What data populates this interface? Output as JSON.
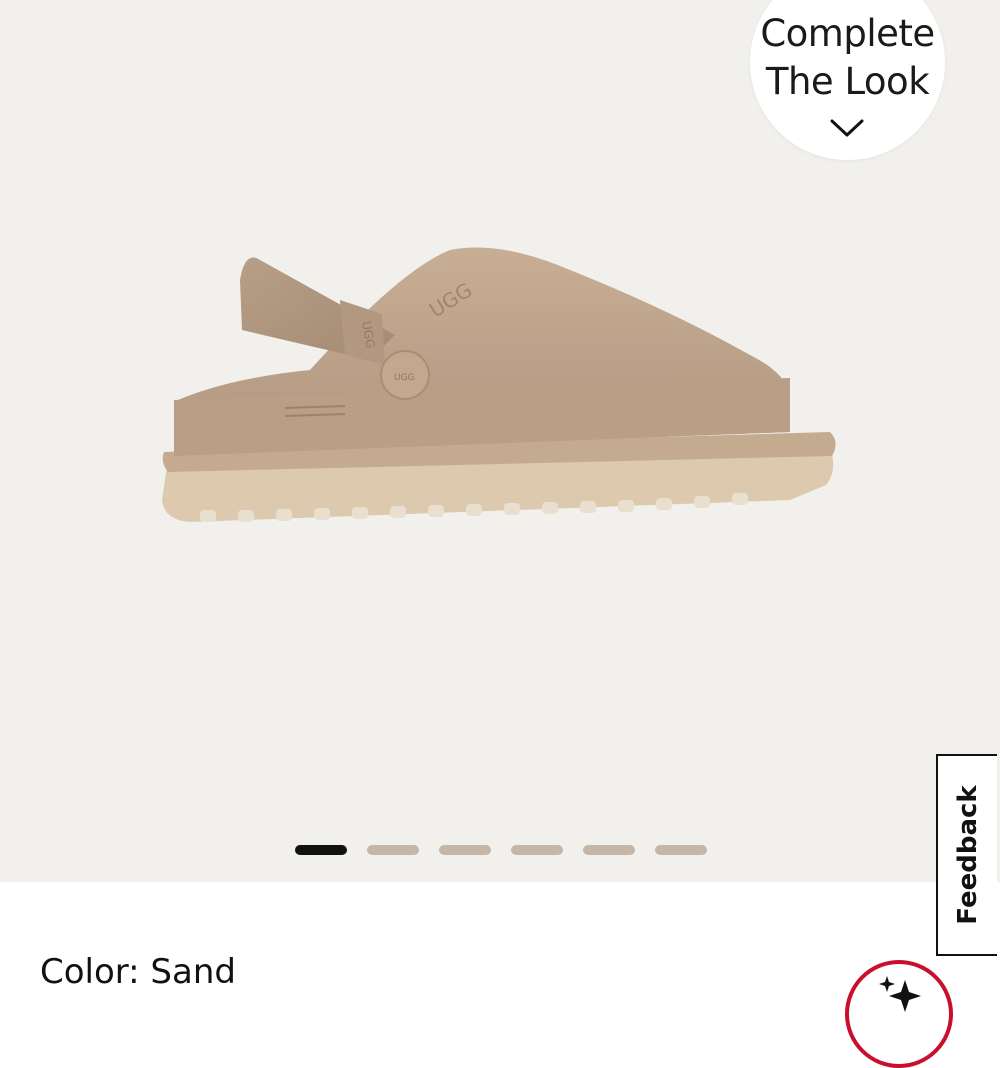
{
  "gallery": {
    "product_image_alt": "UGG",
    "slide_count": 6,
    "active_slide": 1
  },
  "complete_look": {
    "line1": "Complete",
    "line2": "The Look",
    "icon": "chevron-down-icon"
  },
  "feedback": {
    "label": "Feedback"
  },
  "product": {
    "color_label": "Color: Sand"
  },
  "assistant": {
    "icon": "sparkle-icon",
    "accent_color": "#c8102e"
  },
  "colors": {
    "gallery_bg": "#f1f0ec",
    "dot_inactive": "#c4b7a6",
    "dot_active": "#111111"
  }
}
